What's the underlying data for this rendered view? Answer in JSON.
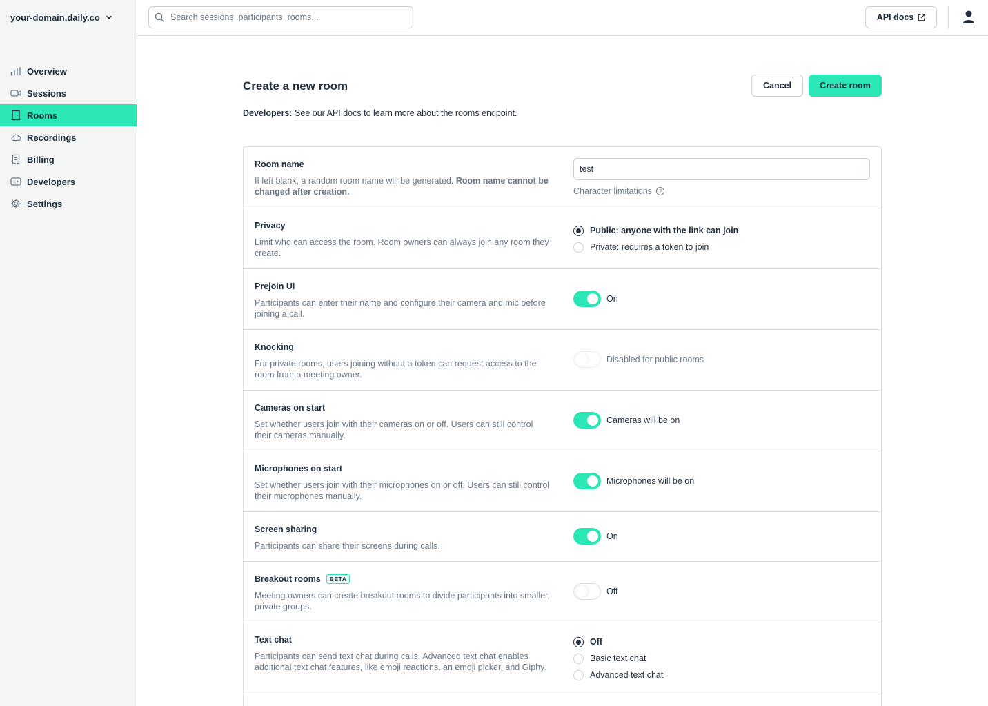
{
  "sidebar": {
    "domain": "your-domain.daily.co",
    "items": [
      {
        "label": "Overview",
        "icon": "bar-chart-icon"
      },
      {
        "label": "Sessions",
        "icon": "video-camera-icon"
      },
      {
        "label": "Rooms",
        "icon": "door-icon",
        "active": true
      },
      {
        "label": "Recordings",
        "icon": "cloud-icon"
      },
      {
        "label": "Billing",
        "icon": "receipt-icon"
      },
      {
        "label": "Developers",
        "icon": "code-icon"
      },
      {
        "label": "Settings",
        "icon": "gear-icon"
      }
    ]
  },
  "topbar": {
    "search_placeholder": "Search sessions, participants, rooms...",
    "api_docs_label": "API docs"
  },
  "page": {
    "title": "Create a new room",
    "cancel_label": "Cancel",
    "create_label": "Create room",
    "dev_prefix": "Developers:",
    "dev_link": "See our API docs",
    "dev_suffix": " to learn more about the rooms endpoint."
  },
  "settings": {
    "room_name": {
      "label": "Room name",
      "desc": "If left blank, a random room name will be generated. ",
      "desc_bold": "Room name cannot be changed after creation.",
      "value": "test",
      "char_limits": "Character limitations"
    },
    "privacy": {
      "label": "Privacy",
      "desc": "Limit who can access the room. Room owners can always join any room they create.",
      "options": [
        "Public: anyone with the link can join",
        "Private: requires a token to join"
      ],
      "selected": 0
    },
    "prejoin": {
      "label": "Prejoin UI",
      "desc": "Participants can enter their name and configure their camera and mic before joining a call.",
      "state": "On"
    },
    "knocking": {
      "label": "Knocking",
      "desc": "For private rooms, users joining without a token can request access to the room from a meeting owner.",
      "state": "Disabled for public rooms"
    },
    "cameras": {
      "label": "Cameras on start",
      "desc": "Set whether users join with their cameras on or off. Users can still control their cameras manually.",
      "state": "Cameras will be on"
    },
    "microphones": {
      "label": "Microphones on start",
      "desc": "Set whether users join with their microphones on or off. Users can still control their microphones manually.",
      "state": "Microphones will be on"
    },
    "screen_sharing": {
      "label": "Screen sharing",
      "desc": "Participants can share their screens during calls.",
      "state": "On"
    },
    "breakout": {
      "label": "Breakout rooms",
      "badge": "BETA",
      "desc": "Meeting owners can create breakout rooms to divide participants into smaller, private groups.",
      "state": "Off"
    },
    "text_chat": {
      "label": "Text chat",
      "desc": "Participants can send text chat during calls. Advanced text chat enables additional text chat features, like emoji reactions, an emoji picker, and Giphy.",
      "options": [
        "Off",
        "Basic text chat",
        "Advanced text chat"
      ],
      "selected": 0
    }
  },
  "colors": {
    "accent": "#2be7b6",
    "text": "#1f2d3d",
    "muted": "#6b7785",
    "border": "#d9dede"
  }
}
